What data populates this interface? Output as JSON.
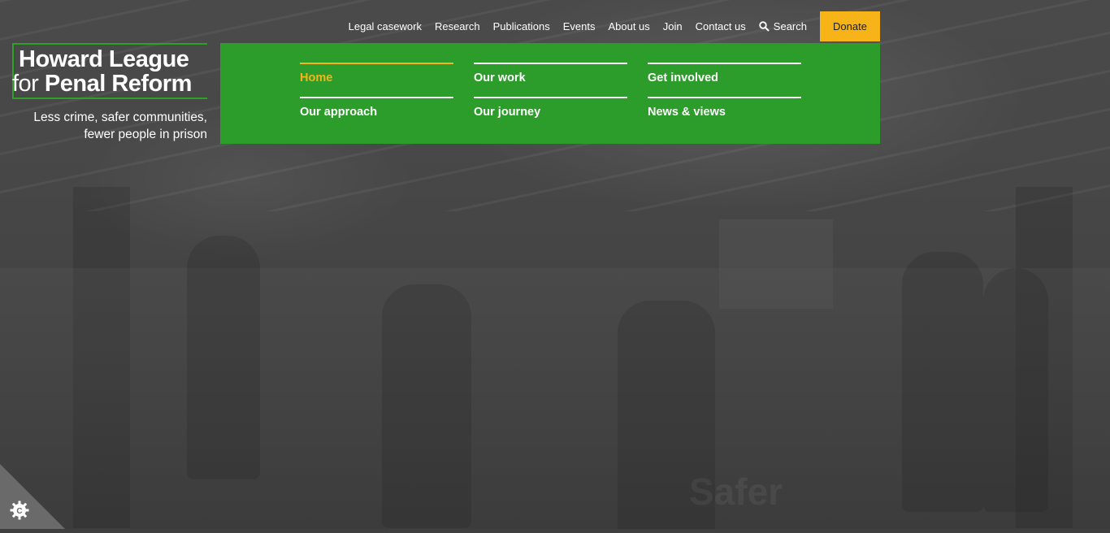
{
  "topnav": {
    "items": [
      "Legal casework",
      "Research",
      "Publications",
      "Events",
      "About us",
      "Join",
      "Contact us"
    ],
    "search_label": "Search",
    "donate_label": "Donate"
  },
  "logo": {
    "line1": "Howard League",
    "line2_prefix": "for",
    "line2_bold": "Penal Reform",
    "tagline_line1": "Less crime, safer communities,",
    "tagline_line2": "fewer people in prison"
  },
  "mega_menu": {
    "items": [
      "Home",
      "Our work",
      "Get involved",
      "Our approach",
      "Our journey",
      "News & views"
    ],
    "active": "Home"
  },
  "background": {
    "partial_text": "Safer"
  },
  "colors": {
    "brand_green": "#2c9c2a",
    "accent_yellow": "#f6b418",
    "background_dark": "#3f3f3f"
  }
}
